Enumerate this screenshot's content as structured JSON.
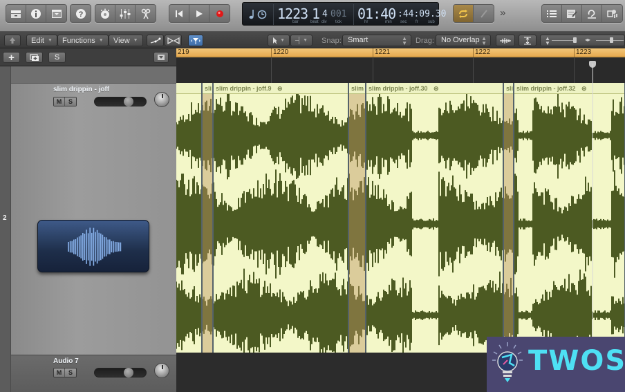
{
  "control_bar": {
    "buttons_left": [
      {
        "icon": "library-icon",
        "label": "Library"
      },
      {
        "icon": "inspector-icon",
        "label": "Inspector"
      },
      {
        "icon": "toolbar-icon",
        "label": "Toolbar"
      },
      {
        "icon": "help-icon",
        "label": "Quick Help"
      },
      {
        "icon": "smart-controls-icon",
        "label": "Smart Controls"
      },
      {
        "icon": "mixer-icon",
        "label": "Mixer"
      },
      {
        "icon": "editors-icon",
        "label": "Editors"
      }
    ],
    "transport": [
      {
        "icon": "go-to-beginning-icon",
        "label": "Go to Beginning"
      },
      {
        "icon": "play-icon",
        "label": "Play"
      },
      {
        "icon": "record-icon",
        "label": "Record"
      }
    ],
    "lcd": {
      "mode_icons": [
        "note-icon",
        "clock-icon"
      ],
      "bar": "1223",
      "beat": "1",
      "div": "4",
      "tick": "001",
      "labels_position": [
        "bar",
        "beat",
        "div",
        "tick"
      ],
      "time_hr_min": "01:40",
      "time_rest": ":44:09.30",
      "labels_time": [
        "hr",
        "min",
        "sec",
        "fr",
        "sub"
      ]
    },
    "cycle_active": true,
    "more_label": "»",
    "buttons_right": [
      {
        "icon": "list-editors-icon",
        "label": "List Editors"
      },
      {
        "icon": "note-pads-icon",
        "label": "Note Pads"
      },
      {
        "icon": "loop-browser-icon",
        "label": "Apple Loops"
      },
      {
        "icon": "media-browser-icon",
        "label": "Browsers"
      }
    ]
  },
  "tracks_toolbar": {
    "back_icon": "up-arrow-icon",
    "menus": [
      "Edit",
      "Functions",
      "View"
    ],
    "snap_label": "Snap:",
    "snap_value": "Smart",
    "drag_label": "Drag:",
    "drag_value": "No Overlap"
  },
  "tracklist_header": {
    "add_label": "+",
    "folder_label": "⊞",
    "s_label": "S"
  },
  "ruler": {
    "bars": [
      "219",
      "1220",
      "1221",
      "1222",
      "1223"
    ]
  },
  "tracks": [
    {
      "number": "2",
      "name": "slim drippin - joff",
      "mute": "M",
      "solo": "S",
      "volume": 0.68,
      "icon": "waveform-icon"
    },
    {
      "name": "Audio 7",
      "mute": "M",
      "solo": "S",
      "volume": 0.68
    }
  ],
  "regions": [
    {
      "name": "",
      "linked": false
    },
    {
      "name": "sli",
      "linked": false
    },
    {
      "name": "slim drippin - joff.9",
      "linked": true
    },
    {
      "name": "slim",
      "linked": false
    },
    {
      "name": "slim drippin - joff.30",
      "linked": true
    },
    {
      "name": "sli",
      "linked": false
    },
    {
      "name": "slim drippin - joff.32",
      "linked": true
    }
  ],
  "colors": {
    "region_bg": "#f3f7c8",
    "waveform": "#4c5a22",
    "ruler": "#eab45c",
    "cycle": "#d9a640"
  },
  "watermark": {
    "text": "TWOS",
    "icon": "lightbulb-icon"
  }
}
